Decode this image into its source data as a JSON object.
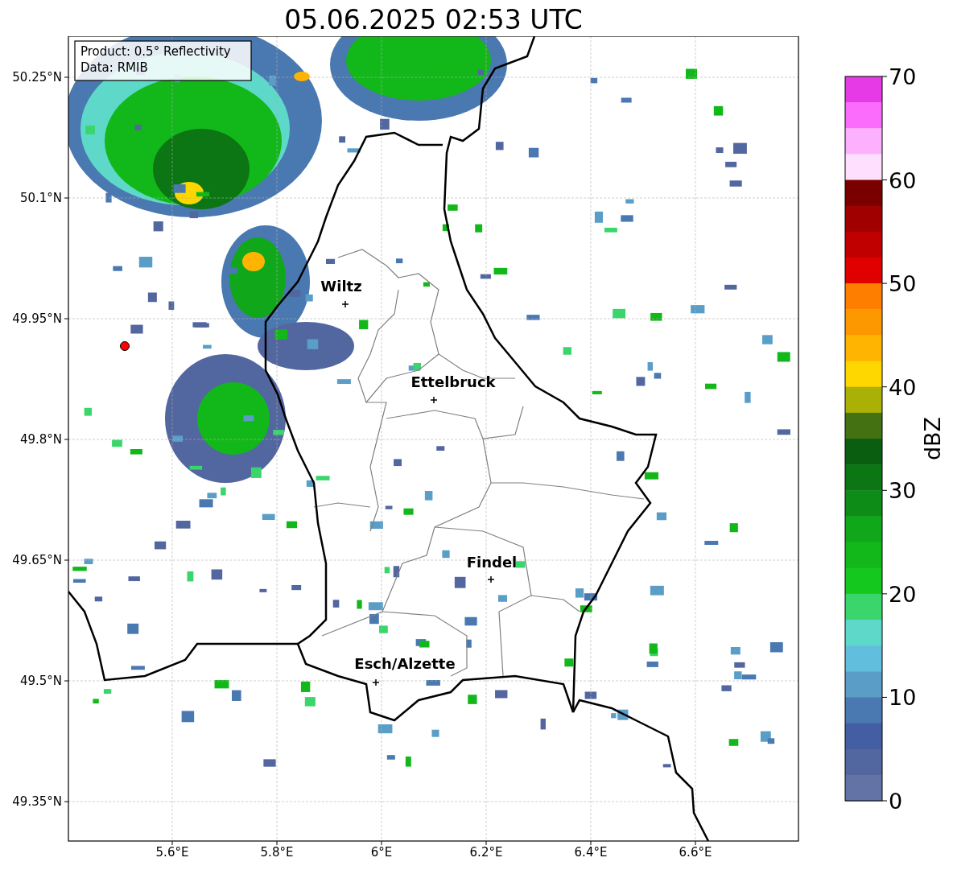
{
  "title": "05.06.2025 02:53 UTC",
  "legend": [
    "Product: 0.5° Reflectivity",
    "Data: RMIB"
  ],
  "x_ticks": [
    "5.6°E",
    "5.8°E",
    "6°E",
    "6.2°E",
    "6.4°E",
    "6.6°E"
  ],
  "y_ticks": [
    "50.25°N",
    "50.1°N",
    "49.95°N",
    "49.8°N",
    "49.65°N",
    "49.5°N",
    "49.35°N"
  ],
  "cities": [
    {
      "name": "Wiltz"
    },
    {
      "name": "Ettelbruck"
    },
    {
      "name": "Findel"
    },
    {
      "name": "Esch/Alzette"
    }
  ],
  "colorbar": {
    "label": "dBZ",
    "ticks": [
      "70",
      "60",
      "50",
      "40",
      "30",
      "20",
      "10",
      "0"
    ],
    "bins": [
      {
        "color": "#e63ae6"
      },
      {
        "color": "#fc6cfc"
      },
      {
        "color": "#fdb0fd"
      },
      {
        "color": "#fee0fe"
      },
      {
        "color": "#7a0000"
      },
      {
        "color": "#a00000"
      },
      {
        "color": "#c00000"
      },
      {
        "color": "#e00000"
      },
      {
        "color": "#fe7e00"
      },
      {
        "color": "#fe9800"
      },
      {
        "color": "#feb400"
      },
      {
        "color": "#fed600"
      },
      {
        "color": "#aab006"
      },
      {
        "color": "#447212"
      },
      {
        "color": "#0a5e10"
      },
      {
        "color": "#0c7514"
      },
      {
        "color": "#0e8c18"
      },
      {
        "color": "#10a81a"
      },
      {
        "color": "#12b81a"
      },
      {
        "color": "#14c81e"
      },
      {
        "color": "#3ad66c"
      },
      {
        "color": "#5ed8c8"
      },
      {
        "color": "#62bedd"
      },
      {
        "color": "#5a9ec8"
      },
      {
        "color": "#4a78b0"
      },
      {
        "color": "#435ea2"
      },
      {
        "color": "#5266a0"
      },
      {
        "color": "#6473a5"
      }
    ]
  }
}
